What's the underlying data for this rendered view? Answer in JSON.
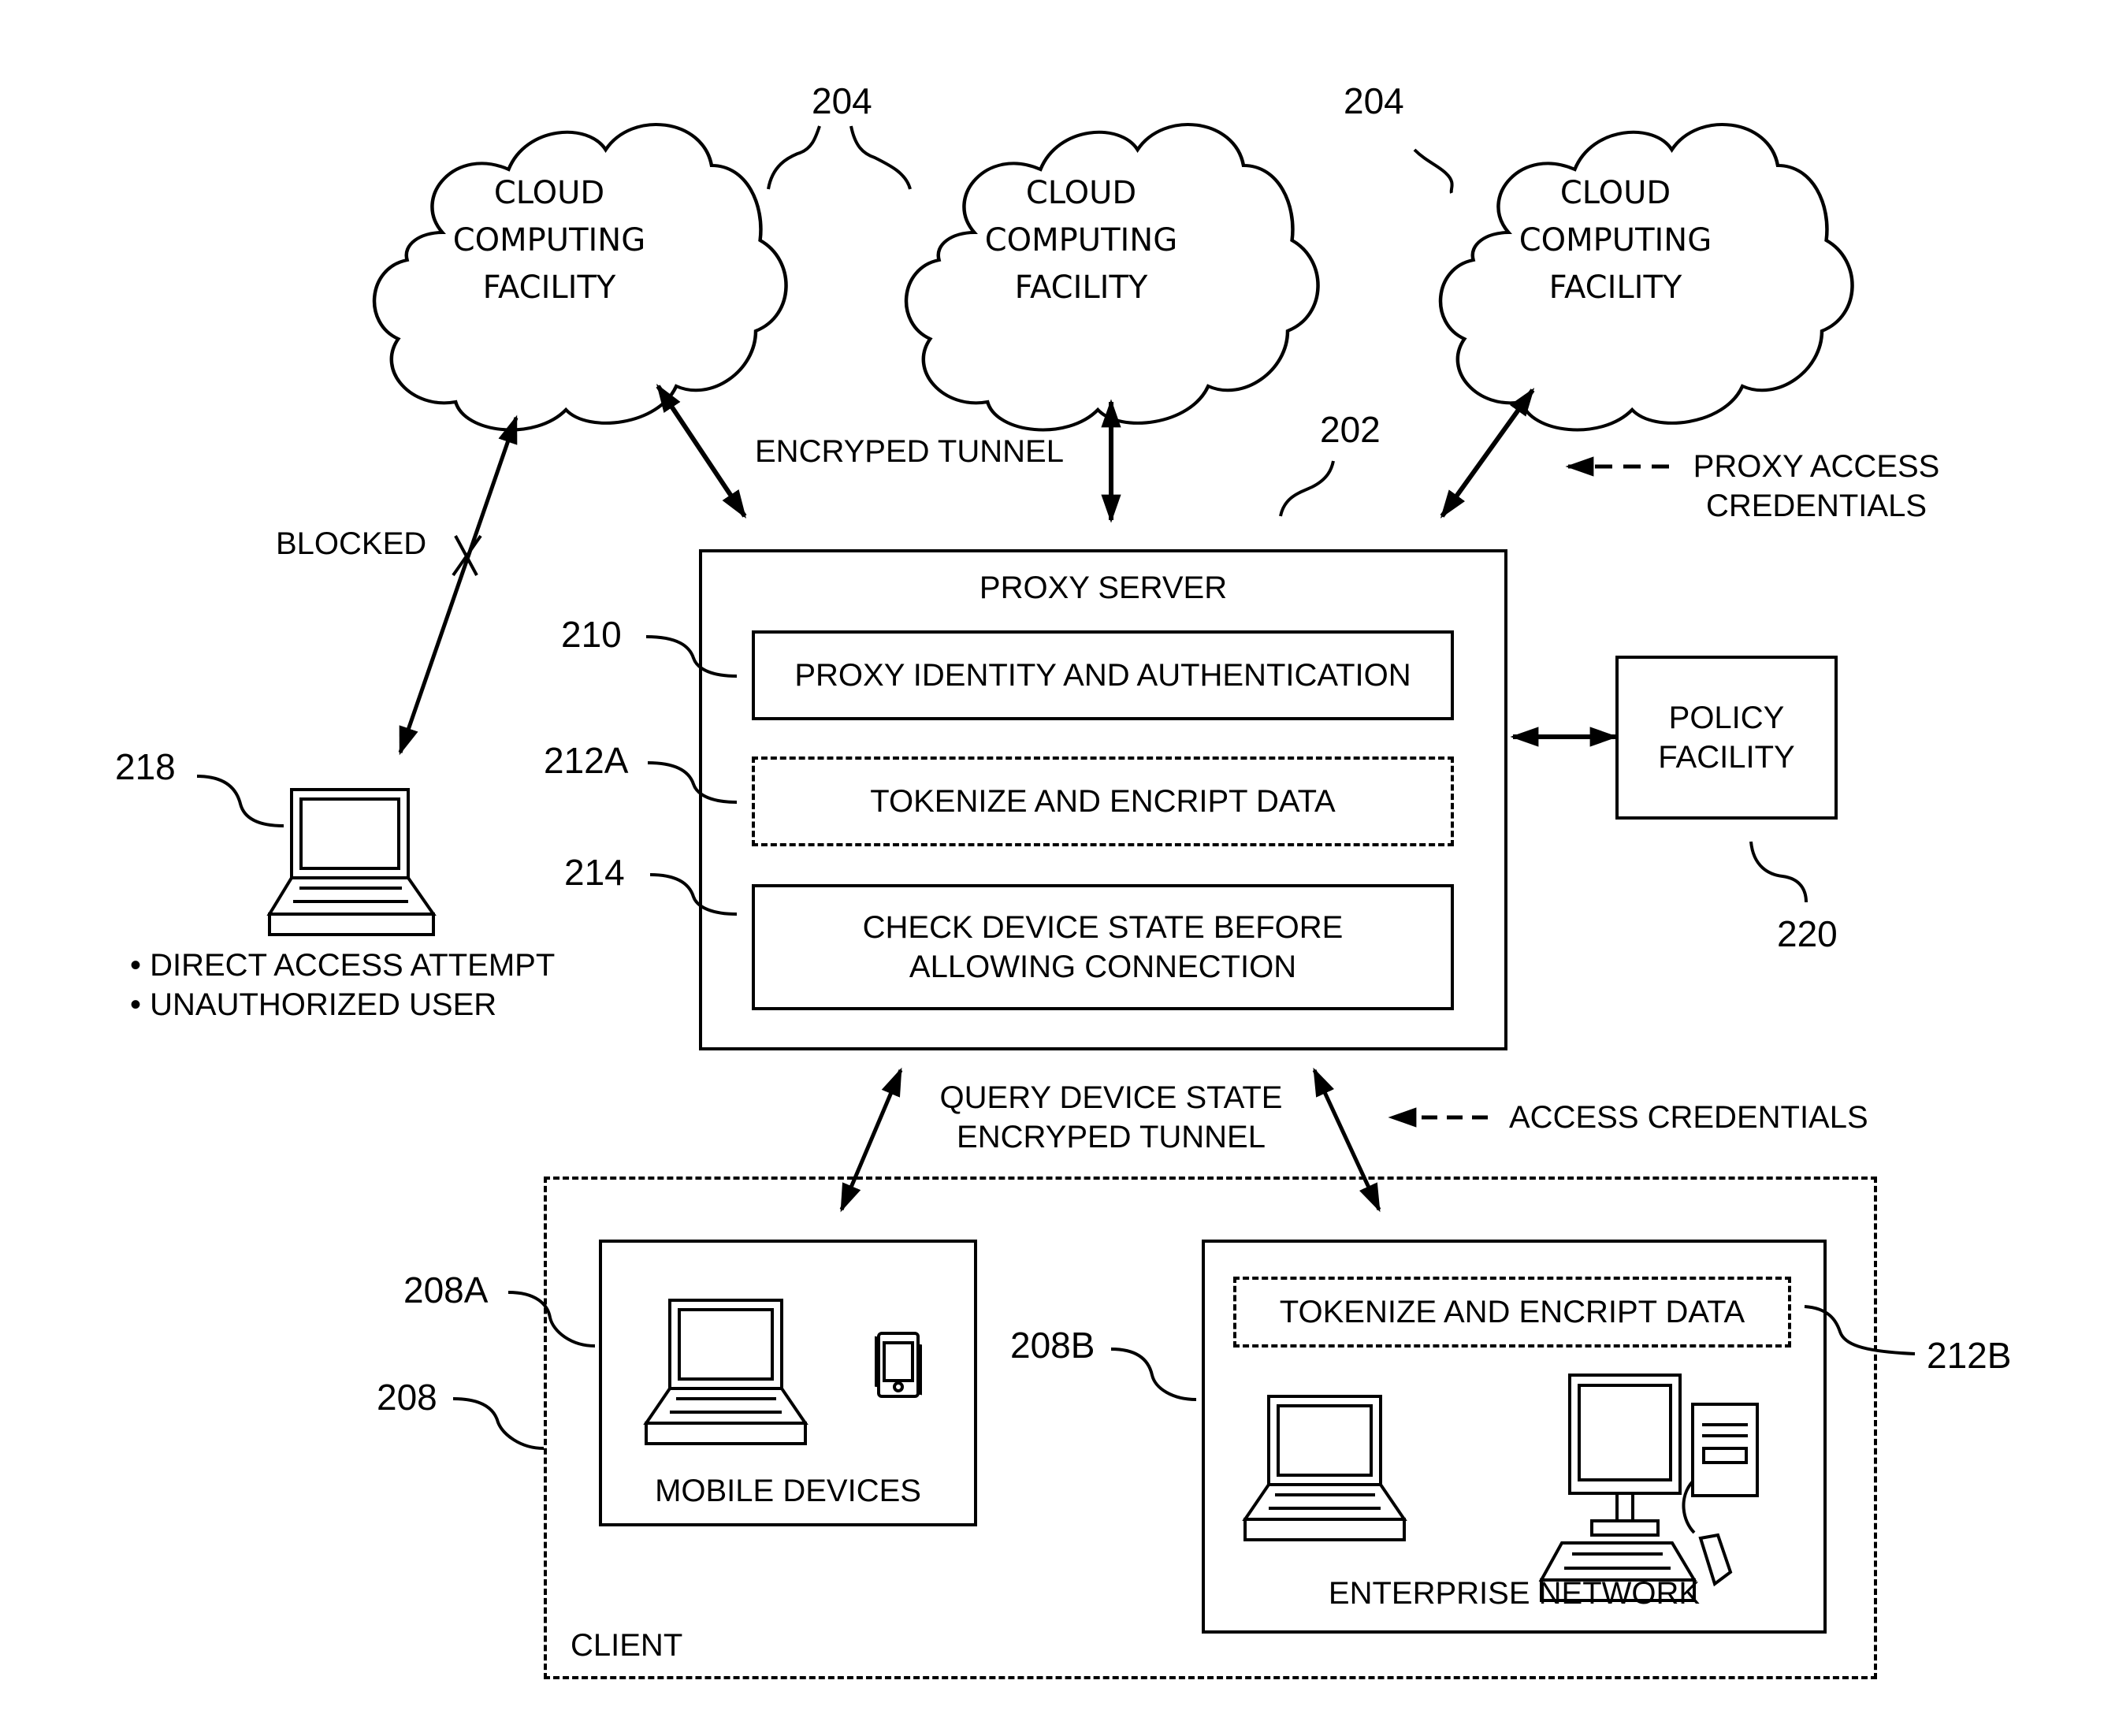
{
  "clouds": [
    {
      "line1": "CLOUD",
      "line2": "COMPUTING",
      "line3": "FACILITY"
    },
    {
      "line1": "CLOUD",
      "line2": "COMPUTING",
      "line3": "FACILITY"
    },
    {
      "line1": "CLOUD",
      "line2": "COMPUTING",
      "line3": "FACILITY"
    }
  ],
  "refs": {
    "clouds_a": "204",
    "clouds_b": "204",
    "proxy": "202",
    "identity": "210",
    "tokenize_a": "212A",
    "device_state": "214",
    "attacker": "218",
    "policy": "220",
    "mobile": "208A",
    "enterprise": "208B",
    "client": "208",
    "tokenize_b": "212B"
  },
  "labels": {
    "encrypted_tunnel_top": "ENCRYPED TUNNEL",
    "blocked": "BLOCKED",
    "proxy_access_line1": "PROXY ACCESS",
    "proxy_access_line2": "CREDENTIALS",
    "query_line1": "QUERY DEVICE STATE",
    "query_line2": "ENCRYPED TUNNEL",
    "access_credentials": "ACCESS CREDENTIALS"
  },
  "proxy_server": {
    "title": "PROXY SERVER",
    "identity": "PROXY IDENTITY AND AUTHENTICATION",
    "tokenize": "TOKENIZE AND ENCRIPT DATA",
    "device_state_line1": "CHECK DEVICE STATE BEFORE",
    "device_state_line2": "ALLOWING CONNECTION"
  },
  "policy": {
    "line1": "POLICY",
    "line2": "FACILITY"
  },
  "attacker": {
    "bullet1": "• DIRECT ACCESS ATTEMPT",
    "bullet2": "• UNAUTHORIZED USER"
  },
  "client": {
    "label": "CLIENT",
    "mobile_label": "MOBILE DEVICES",
    "enterprise_label": "ENTERPRISE NETWORK",
    "enterprise_tokenize": "TOKENIZE AND ENCRIPT DATA"
  }
}
